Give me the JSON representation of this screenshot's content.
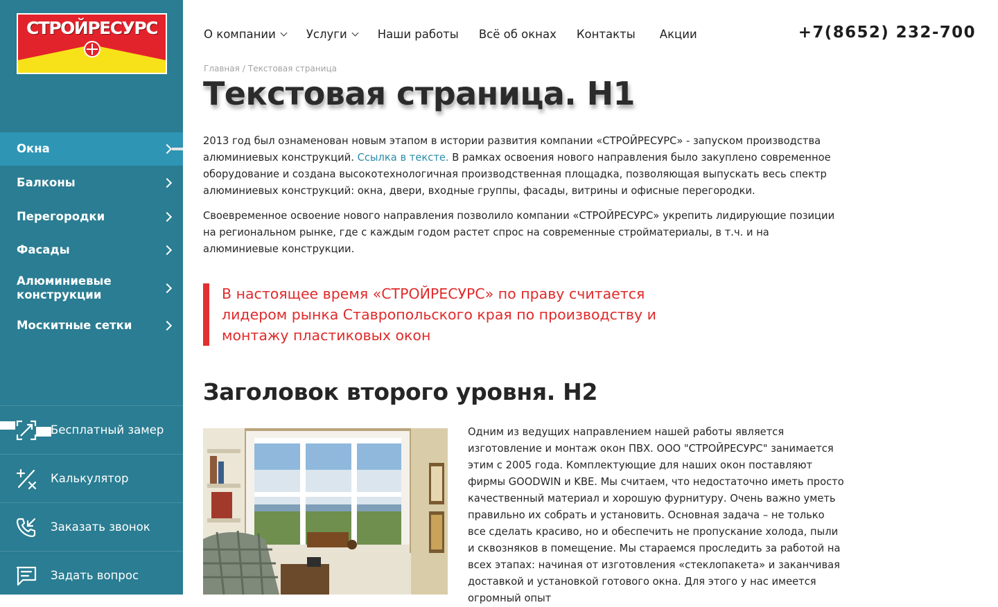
{
  "brand": {
    "logo_text": "СТРОЙРЕСУРС",
    "colors": {
      "sidebar": "#2a7d92",
      "sidebar_active": "#2f95b5",
      "accent_red": "#e32f2f",
      "link": "#2a8ca9"
    }
  },
  "header": {
    "nav": [
      {
        "label": "О компании",
        "dropdown": true
      },
      {
        "label": "Услуги",
        "dropdown": true
      },
      {
        "label": "Наши работы",
        "dropdown": false
      },
      {
        "label": "Всё об окнах",
        "dropdown": false
      },
      {
        "label": "Контакты",
        "dropdown": false
      },
      {
        "label": "Акции",
        "dropdown": false
      }
    ],
    "phone": "+7(8652) 232-700"
  },
  "sidebar": {
    "items": [
      {
        "label": "Окна",
        "active": true
      },
      {
        "label": "Балконы",
        "active": false
      },
      {
        "label": "Перегородки",
        "active": false
      },
      {
        "label": "Фасады",
        "active": false
      },
      {
        "label": "Алюминиевые конструкции",
        "active": false
      },
      {
        "label": "Москитные сетки",
        "active": false
      }
    ],
    "tools": [
      {
        "label": "Бесплатный замер",
        "icon": "measure-icon"
      },
      {
        "label": "Калькулятор",
        "icon": "calculator-icon"
      },
      {
        "label": "Заказать звонок",
        "icon": "phone-callback-icon"
      },
      {
        "label": "Задать вопрос",
        "icon": "chat-question-icon"
      }
    ]
  },
  "breadcrumb": {
    "home": "Главная",
    "separator": "/",
    "current": "Текстовая страница"
  },
  "page": {
    "h1": "Текстовая страница. H1",
    "p1_before_link": "2013 год был ознаменован новым этапом в истории развития компании «СТРОЙРЕСУРС» - запуском производства алюминиевых конструкций. ",
    "p1_link": "Ссылка в тексте.",
    "p1_after_link": " В рамках освоения нового направления было закуплено современное оборудование и создана высокотехнологичная производственная площадка, позволяющая выпускать весь спектр алюминиевых конструкций: окна, двери, входные группы, фасады, витрины и офисные перегородки.",
    "p2": "Своевременное освоение нового направления позволило компании «СТРОЙРЕСУРС» укрепить лидирующие позиции на региональном рынке, где с каждым годом растет спрос на современные стройматериалы, в т.ч. и на алюминиевые конструкции.",
    "quote": "В настоящее время «СТРОЙРЕСУРС» по праву считается лидером рынка Ставропольского края по производству и монтажу пластиковых окон",
    "h2": "Заголовок второго уровня. H2",
    "p3": "Одним из ведущих направлением нашей работы является изготовление и монтаж окон ПВХ. ООО \"СТРОЙРЕСУРС\" занимается этим с 2005 года. Комплектующие для наших окон поставляют фирмы GOODWIN и KBE. Мы считаем, что недостаточно иметь просто качественный материал и хорошую фурнитуру. Очень важно уметь правильно их собрать и установить. Основная задача – не только все сделать красиво, но и обеспечить не пропускание холода, пыли и сквозняков в помещение. Мы стараемся проследить за работой на всех этапах: начиная от изготовления «стеклопакета» и заканчивая доставкой и установкой готового окна. Для этого у нас имеется огромный опыт"
  }
}
